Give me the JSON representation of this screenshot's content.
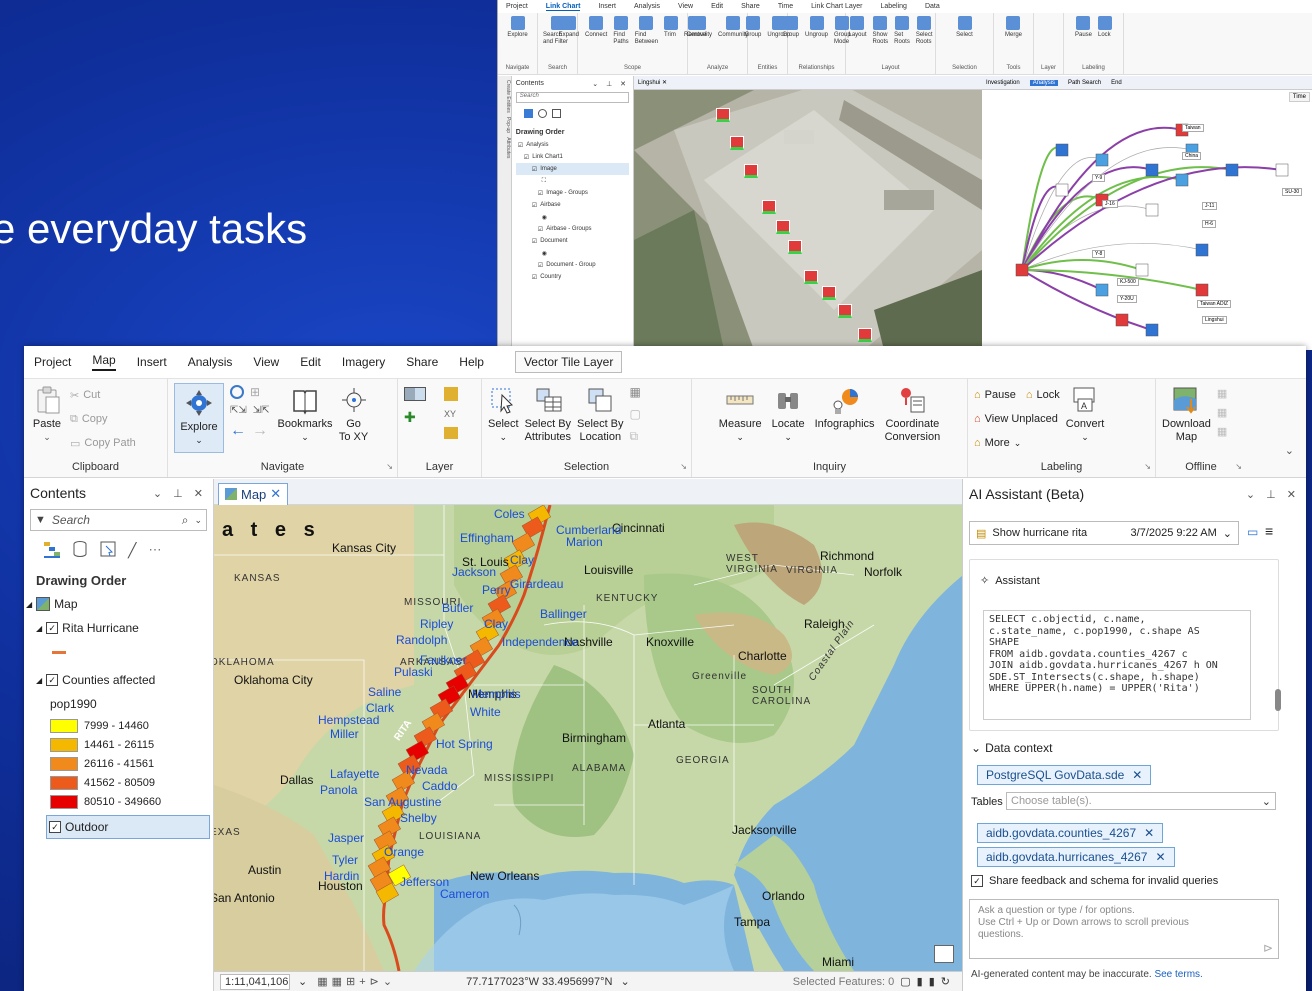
{
  "slide": {
    "text": "e everyday tasks"
  },
  "back_window": {
    "menu": [
      "Project",
      "Link Chart",
      "Insert",
      "Analysis",
      "View",
      "Edit",
      "Share",
      "Time",
      "Link Chart Layer",
      "Labeling",
      "Data"
    ],
    "ribbon_groups": [
      {
        "label": "Navigate",
        "items": [
          "Explore"
        ]
      },
      {
        "label": "Search",
        "items": [
          "Search and Filter"
        ]
      },
      {
        "label": "Scope",
        "items": [
          "Expand",
          "Connect",
          "Find Paths",
          "Find Between",
          "Trim",
          "Remove"
        ]
      },
      {
        "label": "Analyze",
        "items": [
          "Centrality",
          "Community"
        ]
      },
      {
        "label": "Entities",
        "items": [
          "Group",
          "Ungroup"
        ]
      },
      {
        "label": "Relationships",
        "items": [
          "Group",
          "Ungroup",
          "Group Mode"
        ]
      },
      {
        "label": "Layout",
        "items": [
          "Layout",
          "Show Roots",
          "Set Roots",
          "Select Roots"
        ]
      },
      {
        "label": "Selection",
        "items": [
          "Select"
        ]
      },
      {
        "label": "Tools",
        "items": [
          "Merge"
        ]
      },
      {
        "label": "Layer",
        "items": []
      },
      {
        "label": "Labeling",
        "items": [
          "Pause",
          "Lock"
        ]
      }
    ],
    "side_tabs": [
      "Create Entities",
      "Pop-up",
      "Attributes"
    ],
    "contents": {
      "title": "Contents",
      "search_placeholder": "Search",
      "drawing_order": "Drawing Order",
      "rows": [
        "Analysis",
        "Link Chart1",
        "Image",
        "Image - Groups",
        "Airbase",
        "Airbase - Groups",
        "Document",
        "Document - Group",
        "Country"
      ]
    },
    "map_tab": "Lingshui",
    "link_tabs": [
      "Investigation",
      "Analysis",
      "Path Search",
      "End"
    ],
    "link_labels": [
      "Taiwan",
      "China",
      "Y-9",
      "Y-8",
      "J-16",
      "J-11",
      "H-6",
      "Taiwan ADIZ",
      "KJ-500",
      "Y-20U",
      "Lingshui",
      "SU-30",
      "Y-8"
    ],
    "time_label": "Time"
  },
  "menubar": {
    "items": [
      "Project",
      "Map",
      "Insert",
      "Analysis",
      "View",
      "Edit",
      "Imagery",
      "Share",
      "Help"
    ],
    "active": "Map",
    "context_tab": "Vector Tile Layer"
  },
  "ribbon": {
    "clipboard": {
      "label": "Clipboard",
      "paste": "Paste",
      "cut": "Cut",
      "copy": "Copy",
      "copy_path": "Copy Path"
    },
    "navigate": {
      "label": "Navigate",
      "explore": "Explore",
      "bookmarks": "Bookmarks",
      "goto": "Go\nTo XY"
    },
    "layer": {
      "label": "Layer"
    },
    "selection": {
      "label": "Selection",
      "select": "Select",
      "by_attr": "Select By\nAttributes",
      "by_loc": "Select By\nLocation"
    },
    "inquiry": {
      "label": "Inquiry",
      "measure": "Measure",
      "locate": "Locate",
      "infographics": "Infographics",
      "coord": "Coordinate\nConversion"
    },
    "labeling": {
      "label": "Labeling",
      "pause": "Pause",
      "lock": "Lock",
      "view_unplaced": "View Unplaced",
      "more": "More",
      "convert": "Convert"
    },
    "offline": {
      "label": "Offline",
      "download": "Download\nMap"
    }
  },
  "contents": {
    "title": "Contents",
    "search_placeholder": "Search",
    "drawing_order": "Drawing Order",
    "map": "Map",
    "layer_rita": "Rita Hurricane",
    "layer_counties": "Counties affected",
    "field": "pop1990",
    "legend": [
      {
        "label": "7999 - 14460",
        "color": "#ffff00"
      },
      {
        "label": "14461 - 26115",
        "color": "#f5b800"
      },
      {
        "label": "26116 - 41561",
        "color": "#f08a1c"
      },
      {
        "label": "41562 - 80509",
        "color": "#ec5a1c"
      },
      {
        "label": "80510 - 349660",
        "color": "#e60000"
      }
    ],
    "outdoor": "Outdoor",
    "rita_color": "#e6753a"
  },
  "map": {
    "tab": "Map",
    "labels": {
      "states_big": "a t e s",
      "kansas": "KANSAS",
      "oklahoma": "OKLAHOMA",
      "texas": "EXAS",
      "missouri": "MISSOURI",
      "kentucky": "KENTUCKY",
      "west_virginia": "WEST\nVIRGINIA",
      "virginia": "VIRGINIA",
      "arkansas": "ARKANSAS",
      "mississippi": "MISSISSIPPI",
      "alabama": "ALABAMA",
      "georgia": "GEORGIA",
      "south_carolina": "SOUTH\nCAROLINA",
      "louisiana": "LOUISIANA",
      "kansas_city": "Kansas City",
      "st_louis": "St. Louis",
      "cincinnati": "Cincinnati",
      "louisville": "Louisville",
      "richmond": "Richmond",
      "norfolk": "Norfolk",
      "raleigh": "Raleigh",
      "nashville": "Nashville",
      "knoxville": "Knoxville",
      "charlotte": "Charlotte",
      "greenville": "Greenville",
      "oklahoma_city": "Oklahoma City",
      "memphis": "Memphis",
      "atlanta": "Atlanta",
      "birmingham": "Birmingham",
      "dallas": "Dallas",
      "jacksonville": "Jacksonville",
      "austin": "Austin",
      "houston": "Houston",
      "new_orleans": "New Orleans",
      "san_antonio": "San Antonio",
      "orlando": "Orlando",
      "tampa": "Tampa",
      "miami": "Miami",
      "coastal_plain": "Coastal Plain",
      "rita": "RITA"
    },
    "counties": [
      "Coles",
      "Cumberland",
      "Effingham",
      "Marion",
      "Clay",
      "Jackson",
      "Perry",
      "Girardeau",
      "Butler",
      "Ballinger",
      "Ripley",
      "Clay",
      "Randolph",
      "Independence",
      "Faulkner",
      "Pulaski",
      "Memphis",
      "Saline",
      "Clark",
      "White",
      "Hempstead",
      "Miller",
      "Hot Spring",
      "Nevada",
      "Lafayette",
      "Caddo",
      "Panola",
      "San Augustine",
      "Shelby",
      "Jasper",
      "Orange",
      "Tyler",
      "Hardin",
      "Jefferson",
      "Cameron"
    ],
    "status": {
      "scale": "1:11,041,106",
      "coords": "77.7177023°W 33.4956997°N",
      "selected": "Selected Features: 0"
    }
  },
  "ai": {
    "title": "AI Assistant (Beta)",
    "chat_title": "Show hurricane rita",
    "timestamp": "3/7/2025 9:22 AM",
    "assistant_label": "Assistant",
    "sql": "SELECT c.objectid, c.name,\nc.state_name, c.pop1990, c.shape AS\nSHAPE\nFROM aidb.govdata.counties_4267 c\nJOIN aidb.govdata.hurricanes_4267 h ON\nSDE.ST_Intersects(c.shape, h.shape)\nWHERE UPPER(h.name) = UPPER('Rita')",
    "data_context": "Data context",
    "source": "PostgreSQL GovData.sde",
    "tables_label": "Tables",
    "tables_placeholder": "Choose table(s).",
    "table1": "aidb.govdata.counties_4267",
    "table2": "aidb.govdata.hurricanes_4267",
    "share_feedback": "Share feedback and schema for invalid queries",
    "input_placeholder": "Ask a question or type / for options.\nUse Ctrl + Up or Down arrows to scroll previous\nquestions.",
    "disclaimer": "AI-generated content may be inaccurate.",
    "see_terms": "See terms."
  }
}
